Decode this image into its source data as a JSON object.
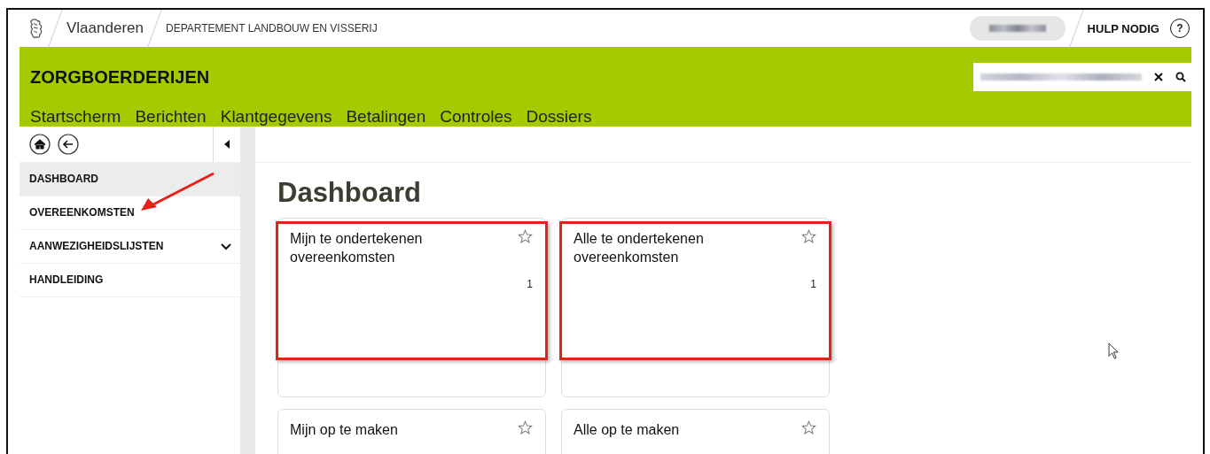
{
  "header": {
    "brand": "Vlaanderen",
    "department": "DEPARTEMENT LANDBOUW EN VISSERIJ",
    "help": "HULP NODIG",
    "help_icon": "?"
  },
  "app": {
    "title": "ZORGBOERDERIJEN",
    "nav": [
      {
        "label": "Startscherm"
      },
      {
        "label": "Berichten"
      },
      {
        "label": "Klantgegevens"
      },
      {
        "label": "Betalingen"
      },
      {
        "label": "Controles"
      },
      {
        "label": "Dossiers"
      }
    ]
  },
  "sidebar": {
    "items": [
      {
        "label": "DASHBOARD",
        "selected": true,
        "expandable": false,
        "annotated": false
      },
      {
        "label": "OVEREENKOMSTEN",
        "selected": false,
        "expandable": false,
        "annotated": true
      },
      {
        "label": "AANWEZIGHEIDSLIJSTEN",
        "selected": false,
        "expandable": true,
        "annotated": false
      },
      {
        "label": "HANDLEIDING",
        "selected": false,
        "expandable": false,
        "annotated": false
      }
    ]
  },
  "page": {
    "title": "Dashboard",
    "cards": [
      {
        "title": "Mijn te ondertekenen overeenkomsten",
        "count": "1",
        "highlighted": true
      },
      {
        "title": "Alle te ondertekenen overeenkomsten",
        "count": "1",
        "highlighted": true
      },
      {
        "title": "Mijn op te maken",
        "highlighted": false
      },
      {
        "title": "Alle op te maken",
        "highlighted": false
      }
    ]
  }
}
